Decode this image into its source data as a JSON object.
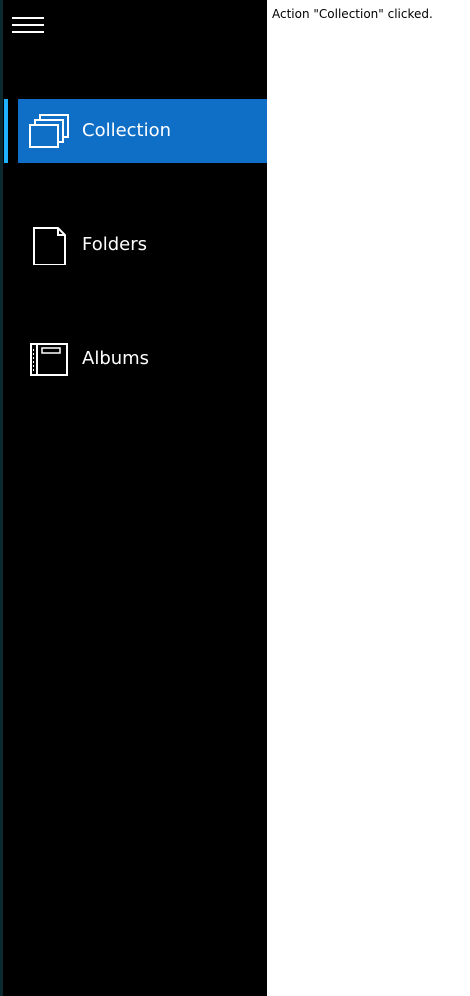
{
  "navigation": {
    "menu_icon": "hamburger-icon",
    "items": [
      {
        "label": "Collection",
        "icon": "collection-icon",
        "selected": true
      },
      {
        "label": "Folders",
        "icon": "folder-icon",
        "selected": false
      },
      {
        "label": "Albums",
        "icon": "album-icon",
        "selected": false
      }
    ]
  },
  "content": {
    "status": "Action \"Collection\" clicked."
  },
  "colors": {
    "pane_background": "#000000",
    "selected_background": "#0f6fc6",
    "selected_indicator": "#1fb2ff",
    "content_background": "#ffffff"
  }
}
